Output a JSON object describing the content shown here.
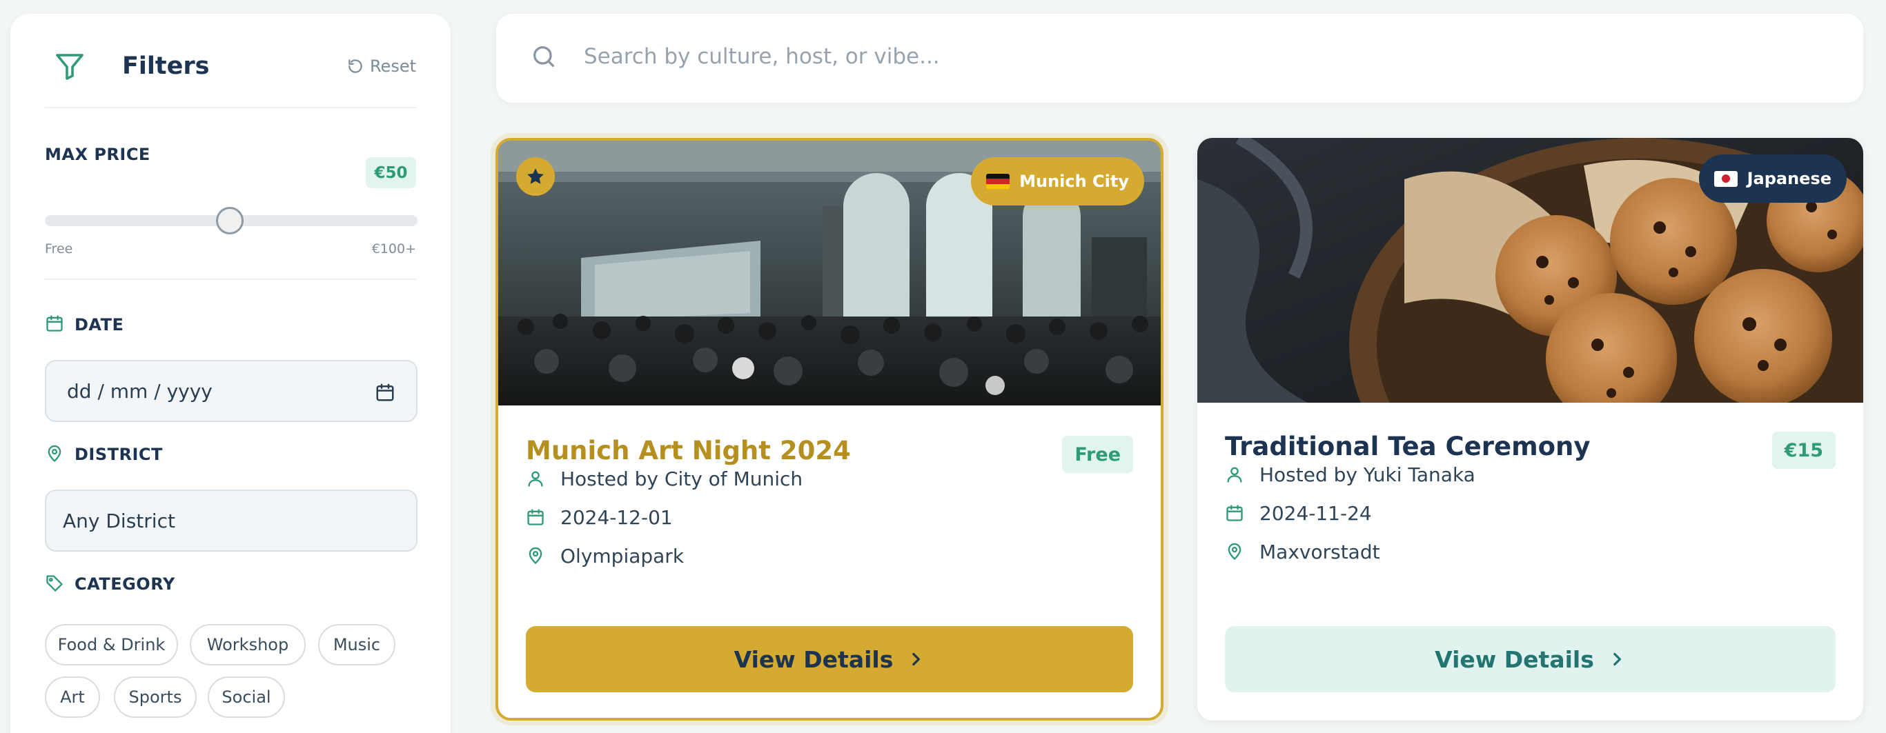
{
  "filters": {
    "title": "Filters",
    "reset_label": "Reset",
    "max_price": {
      "label": "MAX PRICE",
      "value_label": "€50",
      "value": 50,
      "min_label": "Free",
      "max_label": "€100+"
    },
    "date": {
      "label": "DATE",
      "placeholder": "dd / mm / yyyy"
    },
    "district": {
      "label": "DISTRICT",
      "value": "Any District"
    },
    "category": {
      "label": "CATEGORY",
      "options": [
        "Food & Drink",
        "Workshop",
        "Music",
        "Art",
        "Sports",
        "Social"
      ]
    }
  },
  "search": {
    "placeholder": "Search by culture, host, or vibe..."
  },
  "events": [
    {
      "featured": true,
      "culture": "Munich City",
      "title": "Munich Art Night 2024",
      "price": "Free",
      "host": "Hosted by City of Munich",
      "date": "2024-12-01",
      "location": "Olympiapark",
      "cta": "View Details"
    },
    {
      "featured": false,
      "culture": "Japanese",
      "title": "Traditional Tea Ceremony",
      "price": "€15",
      "host": "Hosted by Yuki Tanaka",
      "date": "2024-11-24",
      "location": "Maxvorstadt",
      "cta": "View Details"
    }
  ],
  "colors": {
    "accent_gold": "#d4aa30",
    "navy": "#1c3451",
    "teal": "#2e9a78",
    "teal_light": "#e1f4ee",
    "background": "#f3f6f6"
  },
  "icons": [
    "filter-icon",
    "reset-icon",
    "calendar-icon",
    "map-pin-icon",
    "tag-icon",
    "search-icon",
    "star-icon",
    "user-icon",
    "chevron-right-icon",
    "flag-germany-icon",
    "flag-japan-icon"
  ]
}
